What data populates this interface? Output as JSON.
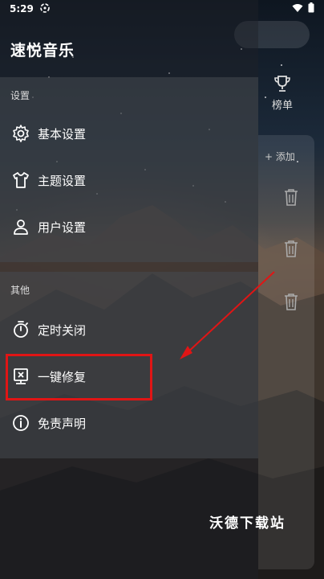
{
  "status_bar": {
    "time": "5:29"
  },
  "drawer": {
    "app_title": "速悦音乐",
    "sections": [
      {
        "label": "设置",
        "items": [
          {
            "label": "基本设置",
            "icon": "gear-icon"
          },
          {
            "label": "主题设置",
            "icon": "shirt-icon"
          },
          {
            "label": "用户设置",
            "icon": "user-icon"
          }
        ]
      },
      {
        "label": "其他",
        "items": [
          {
            "label": "定时关闭",
            "icon": "timer-icon"
          },
          {
            "label": "一键修复",
            "icon": "repair-icon"
          },
          {
            "label": "免责声明",
            "icon": "info-icon"
          }
        ]
      }
    ]
  },
  "background_app": {
    "rank_tab_label": "榜单",
    "add_label": "+ 添加"
  },
  "annotation": {
    "highlight_color": "#e01515"
  },
  "watermark": "沃德下载站"
}
